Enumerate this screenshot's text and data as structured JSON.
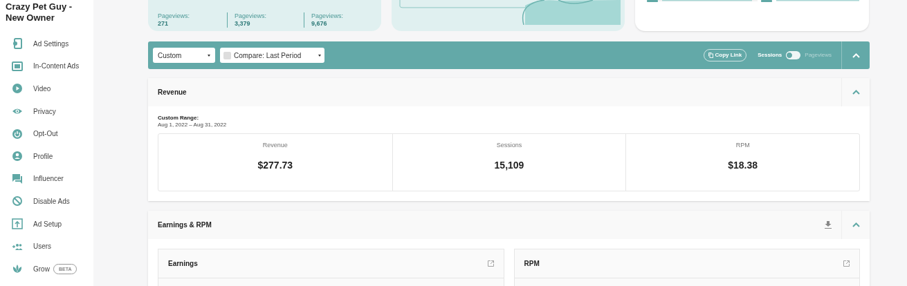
{
  "sidebar": {
    "title": "Crazy Pet Guy - New Owner",
    "items": [
      {
        "kind": "ad-settings",
        "label": "Ad Settings"
      },
      {
        "kind": "in-content",
        "label": "In-Content Ads"
      },
      {
        "kind": "video",
        "label": "Video"
      },
      {
        "kind": "privacy",
        "label": "Privacy"
      },
      {
        "kind": "opt-out",
        "label": "Opt-Out"
      },
      {
        "kind": "profile",
        "label": "Profile"
      },
      {
        "kind": "influencer",
        "label": "Influencer"
      },
      {
        "kind": "disable",
        "label": "Disable Ads"
      },
      {
        "kind": "ad-setup",
        "label": "Ad Setup"
      },
      {
        "kind": "users",
        "label": "Users"
      },
      {
        "kind": "grow",
        "label": "Grow",
        "badge": "BETA"
      }
    ]
  },
  "top_stats": [
    {
      "label": "Pageviews:",
      "value": "271"
    },
    {
      "label": "Pageviews:",
      "value": "3,379"
    },
    {
      "label": "Pageviews:",
      "value": "9,676"
    }
  ],
  "toolbar": {
    "range_select": "Custom",
    "compare_select": "Compare: Last Period",
    "compare_checked": false,
    "copy_link": "Copy Link",
    "toggle_on": false,
    "toggle": [
      {
        "label": "Sessions",
        "selected": true
      },
      {
        "label": "Pageviews",
        "selected": false
      }
    ]
  },
  "revenue": {
    "title": "Revenue",
    "range_label": "Custom Range:",
    "range": "Aug 1, 2022 – Aug 31, 2022",
    "metrics": [
      {
        "label": "Revenue",
        "value": "$277.73"
      },
      {
        "label": "Sessions",
        "value": "15,109"
      },
      {
        "label": "RPM",
        "value": "$18.38"
      }
    ]
  },
  "earnings": {
    "title": "Earnings & RPM",
    "cards": [
      {
        "title": "Earnings"
      },
      {
        "title": "RPM"
      }
    ]
  }
}
